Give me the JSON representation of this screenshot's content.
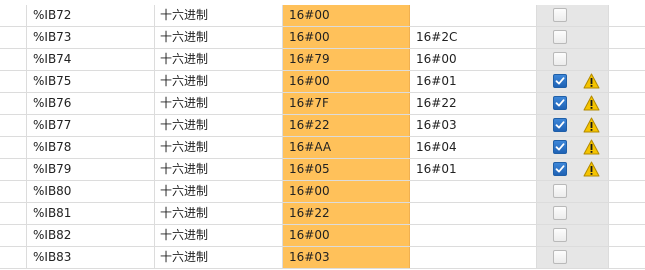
{
  "colors": {
    "value_cell": "#ffc15a",
    "retain_column": "#e6e6e6",
    "checkbox_checked": "#2a6fc4",
    "warning": "#f5c400"
  },
  "rows": [
    {
      "address": "%IB72",
      "format": "十六进制",
      "monitor_value": "16#00",
      "modify_value": "",
      "checked": false,
      "warning": false
    },
    {
      "address": "%IB73",
      "format": "十六进制",
      "monitor_value": "16#00",
      "modify_value": "16#2C",
      "checked": false,
      "warning": false
    },
    {
      "address": "%IB74",
      "format": "十六进制",
      "monitor_value": "16#79",
      "modify_value": "16#00",
      "checked": false,
      "warning": false
    },
    {
      "address": "%IB75",
      "format": "十六进制",
      "monitor_value": "16#00",
      "modify_value": "16#01",
      "checked": true,
      "warning": true
    },
    {
      "address": "%IB76",
      "format": "十六进制",
      "monitor_value": "16#7F",
      "modify_value": "16#22",
      "checked": true,
      "warning": true
    },
    {
      "address": "%IB77",
      "format": "十六进制",
      "monitor_value": "16#22",
      "modify_value": "16#03",
      "checked": true,
      "warning": true
    },
    {
      "address": "%IB78",
      "format": "十六进制",
      "monitor_value": "16#AA",
      "modify_value": "16#04",
      "checked": true,
      "warning": true
    },
    {
      "address": "%IB79",
      "format": "十六进制",
      "monitor_value": "16#05",
      "modify_value": "16#01",
      "checked": true,
      "warning": true
    },
    {
      "address": "%IB80",
      "format": "十六进制",
      "monitor_value": "16#00",
      "modify_value": "",
      "checked": false,
      "warning": false
    },
    {
      "address": "%IB81",
      "format": "十六进制",
      "monitor_value": "16#22",
      "modify_value": "",
      "checked": false,
      "warning": false
    },
    {
      "address": "%IB82",
      "format": "十六进制",
      "monitor_value": "16#00",
      "modify_value": "",
      "checked": false,
      "warning": false
    },
    {
      "address": "%IB83",
      "format": "十六进制",
      "monitor_value": "16#03",
      "modify_value": "",
      "checked": false,
      "warning": false
    }
  ]
}
